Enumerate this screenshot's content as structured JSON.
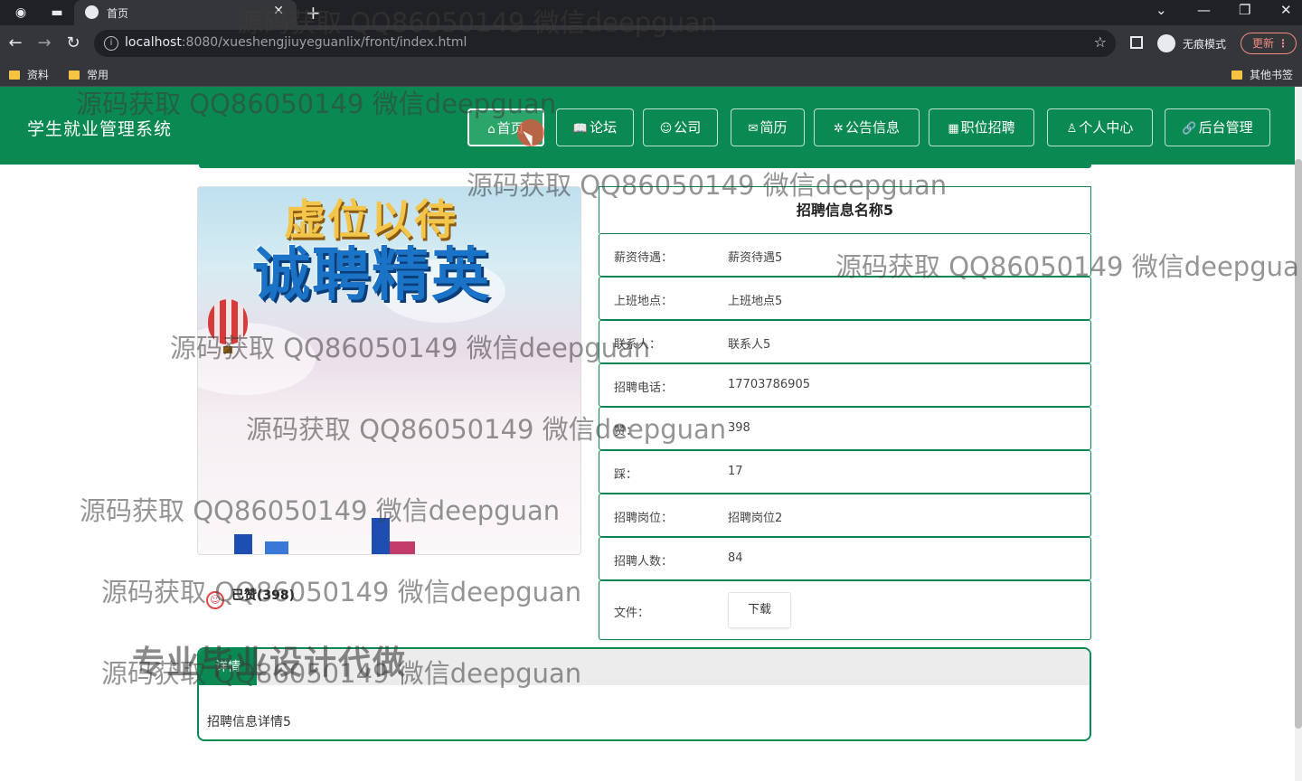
{
  "browser": {
    "tab_title": "首页",
    "url_host": "localhost",
    "url_rest": ":8080/xueshengjiuyeguanlix/front/index.html",
    "incognito_label": "无痕模式",
    "update_label": "更新",
    "bookmarks": [
      "资料",
      "常用"
    ],
    "other_bookmarks": "其他书签"
  },
  "site": {
    "title": "学生就业管理系统",
    "nav": [
      {
        "label": "首页",
        "icon": "home-icon",
        "glyph": "⌂"
      },
      {
        "label": "论坛",
        "icon": "book-icon",
        "glyph": "📖"
      },
      {
        "label": "公司",
        "icon": "smile-icon",
        "glyph": "☺"
      },
      {
        "label": "简历",
        "icon": "mail-icon",
        "glyph": "✉"
      },
      {
        "label": "公告信息",
        "icon": "bell-icon",
        "glyph": "✲"
      },
      {
        "label": "职位招聘",
        "icon": "grid-icon",
        "glyph": "▦"
      },
      {
        "label": "个人中心",
        "icon": "user-icon",
        "glyph": "♙"
      },
      {
        "label": "后台管理",
        "icon": "link-icon",
        "glyph": "🔗"
      }
    ]
  },
  "banner": {
    "line1": "虚位以待",
    "line2": "诚聘精英"
  },
  "vote": {
    "label": "已赞(398)"
  },
  "recruit": {
    "title": "招聘信息名称5",
    "rows": [
      {
        "label": "薪资待遇：",
        "value": "薪资待遇5"
      },
      {
        "label": "上班地点：",
        "value": "上班地点5"
      },
      {
        "label": "联系人：",
        "value": "联系人5"
      },
      {
        "label": "招聘电话：",
        "value": "17703786905"
      },
      {
        "label": "赞：",
        "value": "398"
      },
      {
        "label": "踩：",
        "value": "17"
      },
      {
        "label": "招聘岗位：",
        "value": "招聘岗位2"
      },
      {
        "label": "招聘人数：",
        "value": "84"
      }
    ],
    "file_label": "文件：",
    "download_label": "下载"
  },
  "detail": {
    "tab_label": "详情",
    "text": "招聘信息详情5"
  },
  "watermarks": {
    "text": "源码获取 QQ86050149 微信deepguan",
    "cut_text": "源码获取 QQ86050149 微信deepgua",
    "big_text": "专业毕业设计代做"
  },
  "colors": {
    "brand_green": "#0a8a52",
    "chrome_dark": "#202124"
  }
}
